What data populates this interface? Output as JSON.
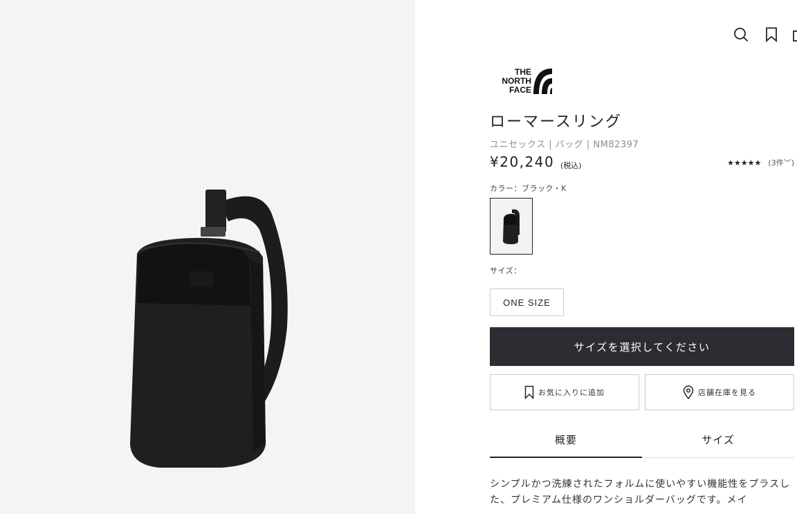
{
  "brand": {
    "logo_lines": [
      "THE",
      "NORTH",
      "FACE"
    ]
  },
  "header": {
    "icons": [
      "search-icon",
      "bookmark-icon",
      "cart-icon"
    ]
  },
  "product": {
    "title": "ローマースリング",
    "breadcrumb": "ユニセックス | バッグ | NM82397",
    "price": "¥20,240",
    "tax_note": "(税込)",
    "rating": {
      "stars": "★★★★★",
      "value": 4.5,
      "count_label": "(3件",
      "chevron": "﹀)"
    },
    "color_label": "カラー：ブラック・K",
    "size_label": "サイズ：",
    "size_option": "ONE SIZE",
    "cta_label": "サイズを選択してください",
    "favorite_label": "お気に入りに追加",
    "store_label": "店舗在庫を見る",
    "tabs": [
      {
        "label": "概要",
        "active": true
      },
      {
        "label": "サイズ",
        "active": false
      }
    ],
    "description": "シンプルかつ洗練されたフォルムに使いやすい機能性をプラスした、プレミアム仕様のワンショルダーバッグです。メイ"
  },
  "colors": {
    "cta_bg": "#2d2c33",
    "gallery_bg": "#f4f4f4",
    "text": "#222222"
  }
}
